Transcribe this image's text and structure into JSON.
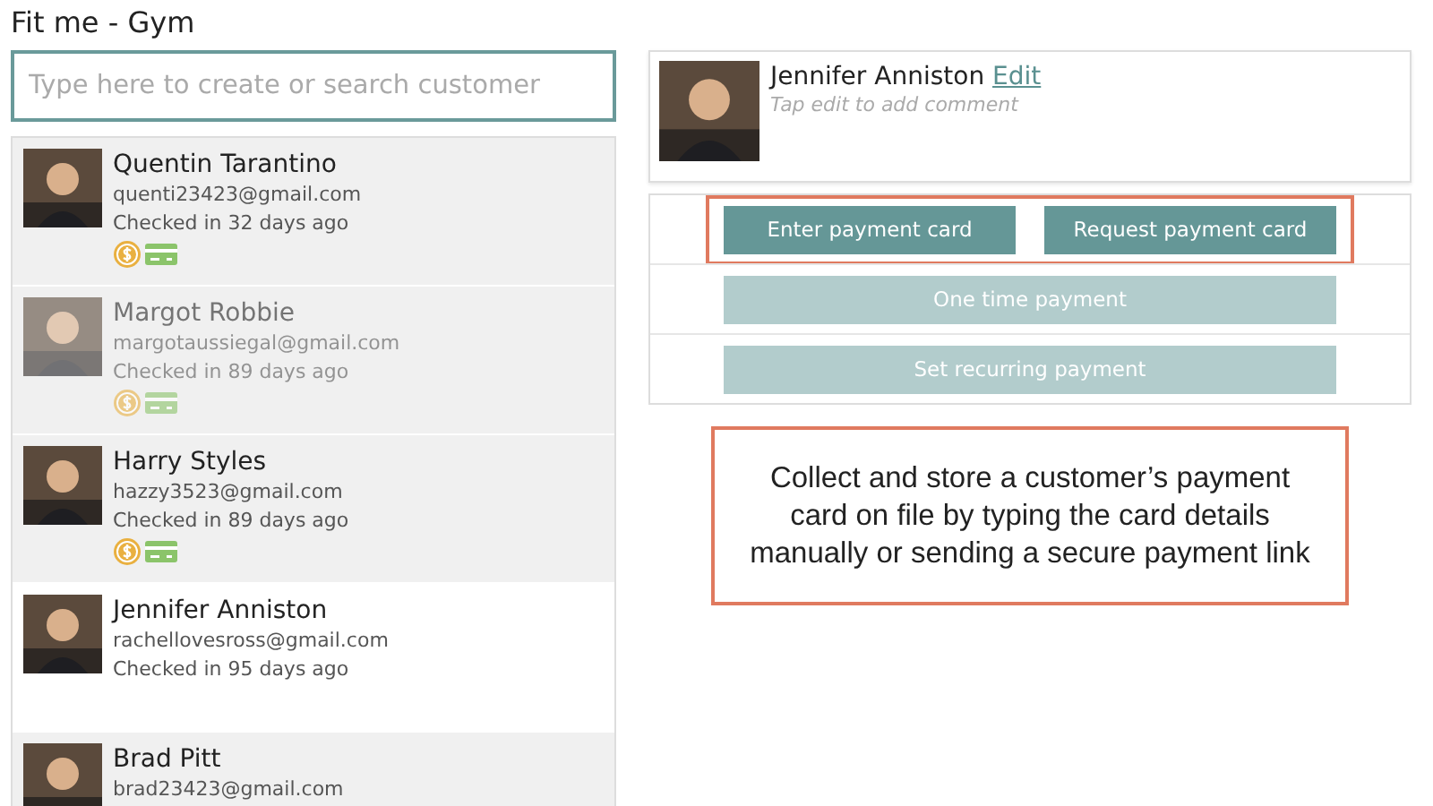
{
  "window": {
    "title": "Fit me - Gym"
  },
  "search": {
    "placeholder": "Type here to create or search customer"
  },
  "customers": [
    {
      "name": "Quentin Tarantino",
      "email": "quenti23423@gmail.com",
      "checked_in": "Checked in 32 days ago",
      "selected": false,
      "dimmed": false,
      "payment_icons": true
    },
    {
      "name": "Margot Robbie",
      "email": "margotaussiegal@gmail.com",
      "checked_in": "Checked in 89 days ago",
      "selected": false,
      "dimmed": true,
      "payment_icons": true
    },
    {
      "name": "Harry Styles",
      "email": "hazzy3523@gmail.com",
      "checked_in": "Checked in 89 days ago",
      "selected": false,
      "dimmed": false,
      "payment_icons": true
    },
    {
      "name": "Jennifer Anniston",
      "email": "rachellovesross@gmail.com",
      "checked_in": "Checked in 95 days ago",
      "selected": true,
      "dimmed": false,
      "payment_icons": false
    },
    {
      "name": "Brad Pitt",
      "email": "brad23423@gmail.com",
      "selected": false,
      "dimmed": false,
      "payment_icons": false
    }
  ],
  "profile": {
    "name": "Jennifer Anniston",
    "edit_link": "Edit",
    "comment_placeholder": "Tap edit to add comment"
  },
  "payment_rows": [
    {
      "highlighted": true,
      "buttons": [
        {
          "label": "Enter payment card",
          "disabled": false
        },
        {
          "label": "Request payment card",
          "disabled": false
        }
      ]
    },
    {
      "highlighted": false,
      "buttons": [
        {
          "label": "One time payment",
          "disabled": true
        }
      ]
    },
    {
      "highlighted": false,
      "buttons": [
        {
          "label": "Set recurring payment",
          "disabled": true
        }
      ]
    }
  ],
  "callout": {
    "text": "Collect and store a customer’s payment card on file by typing the card details manually or sending a secure payment link"
  }
}
